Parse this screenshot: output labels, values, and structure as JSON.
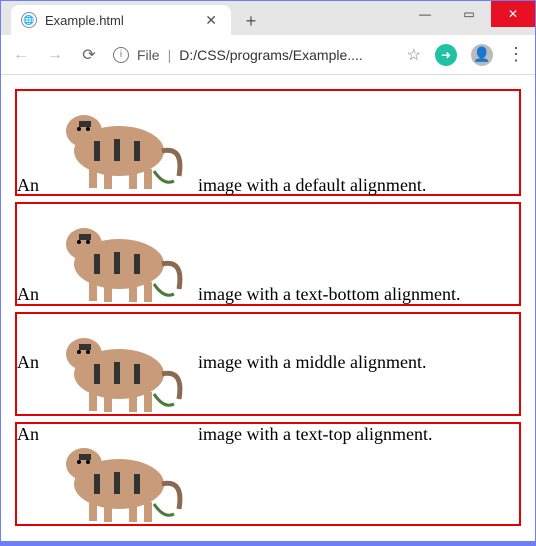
{
  "window": {
    "tab_title": "Example.html"
  },
  "toolbar": {
    "url_scheme_label": "File",
    "url_path": "D:/CSS/programs/Example...."
  },
  "rows": [
    {
      "prefix": "An",
      "suffix": "image with a default alignment."
    },
    {
      "prefix": "An",
      "suffix": "image with a text-bottom alignment."
    },
    {
      "prefix": "An",
      "suffix": "image with a middle alignment."
    },
    {
      "prefix": "An",
      "suffix": "image with a text-top alignment."
    }
  ]
}
